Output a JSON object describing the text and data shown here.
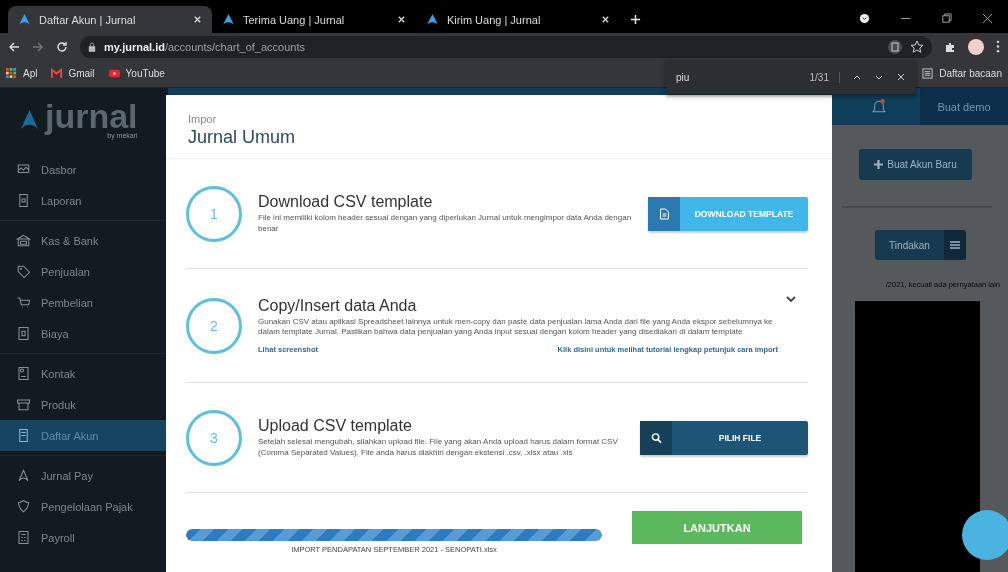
{
  "browser": {
    "tabs": [
      {
        "title": "Daftar Akun | Jurnal",
        "selected": true
      },
      {
        "title": "Terima Uang | Jurnal",
        "selected": false
      },
      {
        "title": "Kirim Uang | Jurnal",
        "selected": false
      }
    ],
    "address": {
      "host": "my.jurnal.id",
      "path": "/accounts/chart_of_accounts"
    },
    "bookmarks": [
      {
        "label": "Apl"
      },
      {
        "label": "Gmail"
      },
      {
        "label": "YouTube"
      }
    ],
    "reading_list": "Daftar bacaan",
    "find_bar": {
      "query": "piu",
      "count": "1/31"
    }
  },
  "sidebar": {
    "logo": "jurnal",
    "logo_sub": "by mekari",
    "groups": [
      {
        "items": [
          {
            "label": "Dasbor",
            "selected": false
          },
          {
            "label": "Laporan",
            "selected": false
          }
        ]
      },
      {
        "items": [
          {
            "label": "Kas & Bank",
            "selected": false
          },
          {
            "label": "Penjualan",
            "selected": false
          },
          {
            "label": "Pembelian",
            "selected": false
          },
          {
            "label": "Biaya",
            "selected": false
          }
        ]
      },
      {
        "items": [
          {
            "label": "Kontak",
            "selected": false
          },
          {
            "label": "Produk",
            "selected": false
          },
          {
            "label": "Daftar Akun",
            "selected": true
          }
        ]
      },
      {
        "items": [
          {
            "label": "Jurnal Pay",
            "selected": false
          },
          {
            "label": "Pengelolaan Pajak",
            "selected": false
          },
          {
            "label": "Payroll",
            "selected": false
          }
        ]
      }
    ]
  },
  "header": {
    "demo_button": "Buat demo"
  },
  "page": {
    "new_account_button": "Buat Akun Baru",
    "actions_button": "Tindakan",
    "note": "/2021, kecuali ada pernyataan lain"
  },
  "modal": {
    "subtitle": "Impor",
    "title": "Jurnal Umum",
    "steps": [
      {
        "kind": "download",
        "number": "1",
        "title": "Download CSV template",
        "description": "File ini memiliki kolom header sesuai dengan yang diperlukan Jurnal untuk mengimpor data Anda dengan benar",
        "button": "DOWNLOAD TEMPLATE"
      },
      {
        "kind": "info",
        "number": "2",
        "title": "Copy/Insert data Anda",
        "description": "Gunakan CSV atau aplikasi Spreadsheet lainnya untuk men-copy dan paste data penjualan lama Anda dari file yang Anda ekspor sebelumnya ke dalam template Jurnal. Pastikan bahwa data penjualan yang Anda input sesuai dengan kolom header yang disediakan di dalam template",
        "links": [
          "Lihat screenshot",
          "Klik disini untuk melihat tutorial lengkap petunjuk cara import"
        ]
      },
      {
        "kind": "upload",
        "number": "3",
        "title": "Upload CSV template",
        "description": "Setelah selesai mengubah, silahkan upload file. File yang akan Anda upload harus dalam format CSV (Comma Separated Values). File anda harus diakhiri dengan ekstensi .csv, .xlsx atau .xls",
        "button": "PILIH FILE"
      }
    ],
    "upload": {
      "level": 1,
      "file_name": "IMPORT PENDAPATAN SEPTEMBER 2021 - SENOPATI.xlsx"
    },
    "continue_button": "LANJUTKAN"
  }
}
